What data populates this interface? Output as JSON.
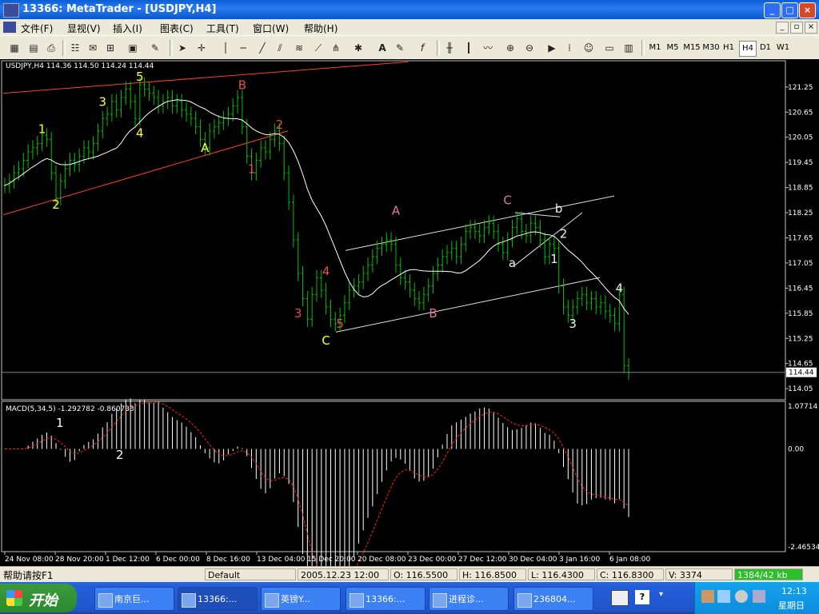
{
  "window": {
    "title": "13366: MetaTrader - [USDJPY,H4]"
  },
  "menu": [
    {
      "label": "文件(F)"
    },
    {
      "label": "显视(V)"
    },
    {
      "label": "插入(I)"
    },
    {
      "label": "图表(C)"
    },
    {
      "label": "工具(T)"
    },
    {
      "label": "窗口(W)"
    },
    {
      "label": "帮助(H)"
    }
  ],
  "toolbar": {
    "icons": [
      "new-chart-icon",
      "open-icon",
      "save-icon",
      "print-icon",
      "market-watch-icon",
      "data-window-icon",
      "navigator-icon",
      "terminal-icon",
      "tester-icon",
      "cursor-icon",
      "crosshair-icon",
      "vertical-line-icon",
      "horizontal-line-icon",
      "trendline-icon",
      "channel-icon",
      "fibonacci-icon",
      "fan-icon",
      "text-icon",
      "label-icon",
      "fx-icon",
      "bar-chart-icon",
      "candles-icon",
      "line-chart-icon",
      "zoom-in-icon",
      "zoom-out-icon",
      "autoscroll-icon",
      "chart-shift-icon",
      "expert-advisor-icon",
      "periodicity-icon",
      "templates-icon"
    ],
    "timeframes": [
      "M1",
      "M5",
      "M15",
      "M30",
      "H1",
      "H4",
      "D1",
      "W1"
    ],
    "active_timeframe": "H4"
  },
  "chart_data": [
    {
      "type": "candlestick",
      "title": "USDJPY,H4  114.36 114.50 114.24 114.44",
      "symbol": "USDJPY",
      "period": "H4",
      "ohlc_last": {
        "open": 114.36,
        "high": 114.5,
        "low": 114.24,
        "close": 114.44
      },
      "bar_color": "#00c000",
      "ylim": [
        113.9,
        121.8
      ],
      "yticks": [
        "121.25",
        "120.65",
        "120.05",
        "119.45",
        "118.85",
        "118.25",
        "117.65",
        "117.05",
        "116.45",
        "115.85",
        "115.25",
        "114.65",
        "114.05"
      ],
      "current_price": "114.44",
      "wave_labels": [
        {
          "text": "1",
          "price": 120.15,
          "bar": 8
        },
        {
          "text": "2",
          "price": 118.35,
          "bar": 11
        },
        {
          "text": "3",
          "price": 120.8,
          "bar": 21
        },
        {
          "text": "4",
          "price": 120.05,
          "bar": 29
        },
        {
          "text": "5",
          "price": 121.4,
          "bar": 29
        },
        {
          "text": "A",
          "price": 119.7,
          "bar": 43
        },
        {
          "text": "B",
          "price": 121.2,
          "bar": 51
        },
        {
          "text": "1",
          "price": 119.2,
          "bar": 53
        },
        {
          "text": "2",
          "price": 120.25,
          "bar": 59
        },
        {
          "text": "3",
          "price": 115.75,
          "bar": 63
        },
        {
          "text": "4",
          "price": 116.75,
          "bar": 69
        },
        {
          "text": "5",
          "price": 115.5,
          "bar": 72
        },
        {
          "text": "C",
          "price": 115.1,
          "bar": 69
        },
        {
          "text": "A",
          "price": 118.2,
          "bar": 84
        },
        {
          "text": "B",
          "price": 115.75,
          "bar": 92
        },
        {
          "text": "C",
          "price": 118.45,
          "bar": 108
        },
        {
          "text": "a",
          "price": 116.95,
          "bar": 109
        },
        {
          "text": "b",
          "price": 118.25,
          "bar": 119
        },
        {
          "text": "1",
          "price": 117.05,
          "bar": 118
        },
        {
          "text": "2",
          "price": 117.65,
          "bar": 120
        },
        {
          "text": "3",
          "price": 115.5,
          "bar": 122
        },
        {
          "text": "4",
          "price": 116.35,
          "bar": 132
        }
      ],
      "close_series": [
        118.9,
        119.0,
        119.2,
        119.3,
        119.5,
        119.7,
        119.8,
        119.9,
        120.1,
        120.0,
        119.2,
        118.6,
        119.0,
        119.3,
        119.5,
        119.4,
        119.6,
        119.8,
        119.7,
        119.9,
        120.2,
        120.5,
        120.6,
        120.9,
        120.7,
        121.0,
        121.2,
        120.9,
        120.5,
        121.3,
        121.2,
        121.1,
        121.0,
        120.8,
        120.9,
        121.0,
        120.8,
        120.9,
        120.7,
        120.6,
        120.5,
        120.3,
        120.0,
        119.8,
        120.2,
        120.3,
        120.4,
        120.5,
        120.6,
        120.8,
        121.0,
        120.3,
        119.6,
        119.2,
        119.5,
        119.8,
        119.7,
        120.0,
        120.2,
        119.9,
        119.2,
        118.5,
        117.6,
        116.8,
        116.2,
        115.7,
        116.3,
        116.7,
        116.4,
        116.0,
        115.7,
        115.6,
        115.8,
        116.1,
        116.4,
        116.5,
        116.6,
        116.8,
        117.0,
        117.2,
        117.4,
        117.5,
        117.6,
        117.5,
        117.0,
        116.7,
        116.6,
        116.4,
        116.2,
        116.1,
        116.3,
        116.5,
        116.8,
        117.0,
        117.2,
        117.3,
        117.4,
        117.2,
        117.5,
        117.8,
        117.9,
        117.8,
        117.7,
        117.9,
        118.0,
        117.8,
        117.5,
        117.3,
        117.6,
        117.9,
        118.1,
        117.8,
        117.7,
        118.0,
        117.9,
        117.6,
        117.2,
        117.5,
        117.4,
        116.5,
        116.0,
        115.8,
        116.0,
        116.2,
        116.3,
        116.1,
        116.2,
        116.0,
        116.1,
        115.9,
        115.8,
        115.6,
        116.3,
        114.6,
        114.44
      ],
      "ma_color": "#ffffff",
      "channel_color": "#ff4020",
      "xticks": [
        "24 Nov 08:00",
        "28 Nov 20:00",
        "1 Dec 12:00",
        "6 Dec 00:00",
        "8 Dec 16:00",
        "13 Dec 04:00",
        "15 Dec 20:00",
        "20 Dec 08:00",
        "23 Dec 00:00",
        "27 Dec 12:00",
        "30 Dec 04:00",
        "3 Jan 16:00",
        "6 Jan 08:00"
      ]
    },
    {
      "type": "bar",
      "title": "MACD(5,34,5)  -1.292782  -0.860733",
      "indicator": "MACD(5,34,5)",
      "values_shown": {
        "main": -1.292782,
        "signal": -0.860733
      },
      "ylim": [
        -2.46534,
        1.07714
      ],
      "yticks": [
        "1.07714",
        "0.00",
        "-2.46534"
      ],
      "histogram_color": "#ffffff",
      "signal_color": "#ff2020",
      "labels": [
        {
          "text": "1",
          "bar": 11
        },
        {
          "text": "2",
          "bar": 17
        }
      ]
    }
  ],
  "status": {
    "help": "帮助请按F1",
    "profile": "Default",
    "time": "2005.12.23 12:00",
    "open": "O: 116.5500",
    "high": "H: 116.8500",
    "low": "L: 116.4300",
    "close": "C: 116.8300",
    "volume": "V: 3374",
    "traffic": "1384/42 kb"
  },
  "taskbar": {
    "start": "开始",
    "tasks": [
      {
        "label": "南京巨..."
      },
      {
        "label": "13366:..."
      },
      {
        "label": "英镑Y..."
      },
      {
        "label": "13366:..."
      },
      {
        "label": "进程诊..."
      },
      {
        "label": "236804..."
      }
    ],
    "clock": "12:13",
    "day": "星期日"
  },
  "window_buttons": {
    "min": "_",
    "max": "□",
    "close": "×",
    "mdi_min": "_",
    "mdi_restore": "▫",
    "mdi_close": "×"
  }
}
